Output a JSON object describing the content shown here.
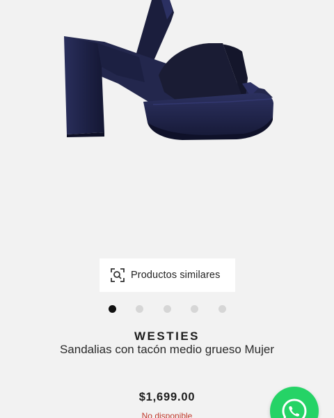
{
  "similar_products": {
    "label": "Productos similares",
    "icon": "visual-search-icon"
  },
  "carousel": {
    "total": 5,
    "active_index": 0
  },
  "product": {
    "brand": "WESTIES",
    "name": "Sandalias con tacón medio grueso Mujer",
    "price": "$1,699.00",
    "availability": "No disponible"
  },
  "whatsapp": {
    "icon": "whatsapp-icon"
  },
  "colors": {
    "background": "#f2f2f2",
    "shoe": "#1a1d3a",
    "availability": "#c0392b",
    "whatsapp": "#25d366",
    "dot_active": "#111111",
    "dot_inactive": "#d6d6d6"
  }
}
